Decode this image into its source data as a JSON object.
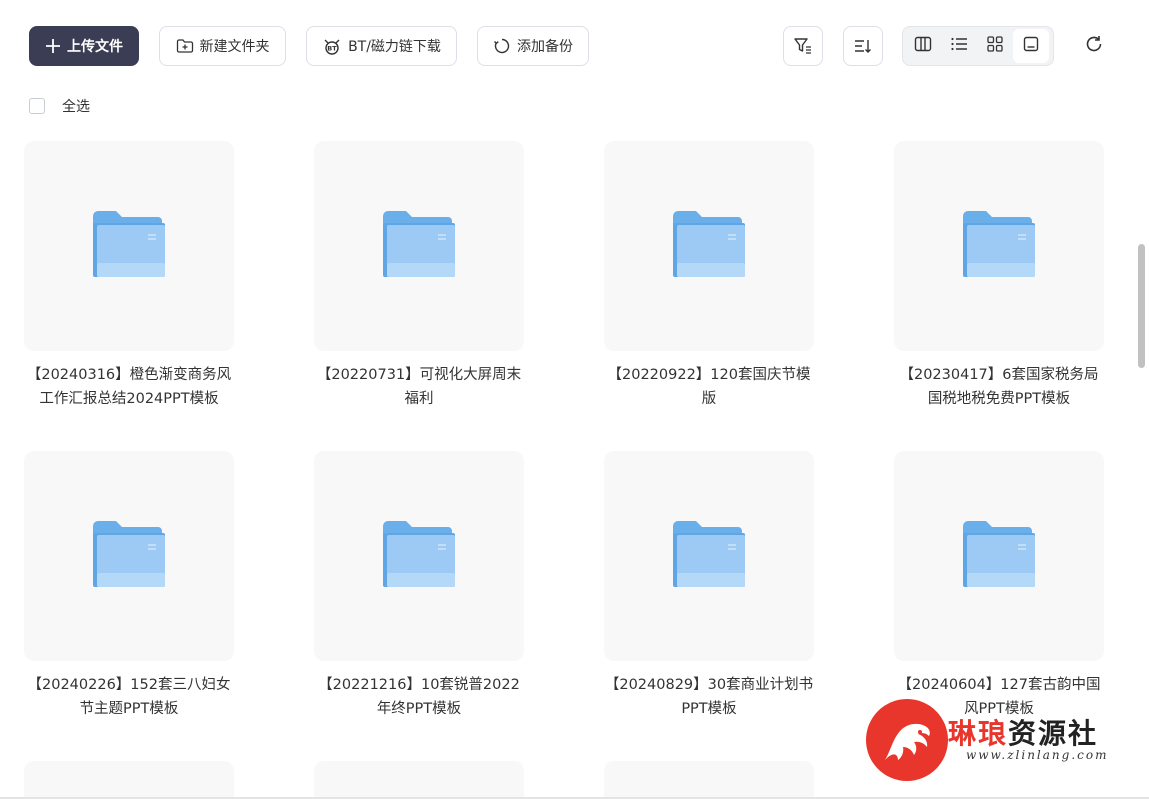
{
  "toolbar": {
    "upload_label": "上传文件",
    "new_folder_label": "新建文件夹",
    "bt_label": "BT/磁力链下载",
    "backup_label": "添加备份",
    "icons": {
      "upload": "plus-icon",
      "new_folder": "folder-plus-icon",
      "bt": "bt-icon",
      "backup": "sync-icon",
      "filter": "filter-icon",
      "sort": "sort-icon",
      "refresh": "refresh-icon"
    },
    "views": [
      "columns-view",
      "list-view",
      "grid-view",
      "thumbnail-view"
    ],
    "active_view": "thumbnail-view"
  },
  "select_all_label": "全选",
  "folders": [
    {
      "name": "【20240316】橙色渐变商务风工作汇报总结2024PPT模板"
    },
    {
      "name": "【20220731】可视化大屏周末福利"
    },
    {
      "name": "【20220922】120套国庆节模版"
    },
    {
      "name": "【20230417】6套国家税务局国税地税免费PPT模板"
    },
    {
      "name": "【20240226】152套三八妇女节主题PPT模板"
    },
    {
      "name": "【20221216】10套锐普2022年终PPT模板"
    },
    {
      "name": "【20240829】30套商业计划书PPT模板"
    },
    {
      "name": "【20240604】127套古韵中国风PPT模板"
    }
  ],
  "watermark": {
    "title_part1": "琳琅",
    "title_part2": "资源社",
    "url": "www.zlinlang.com"
  },
  "colors": {
    "primary_button": "#3b3d55",
    "folder_blue": "#8fc3f3",
    "accent_red": "#e8362d"
  }
}
